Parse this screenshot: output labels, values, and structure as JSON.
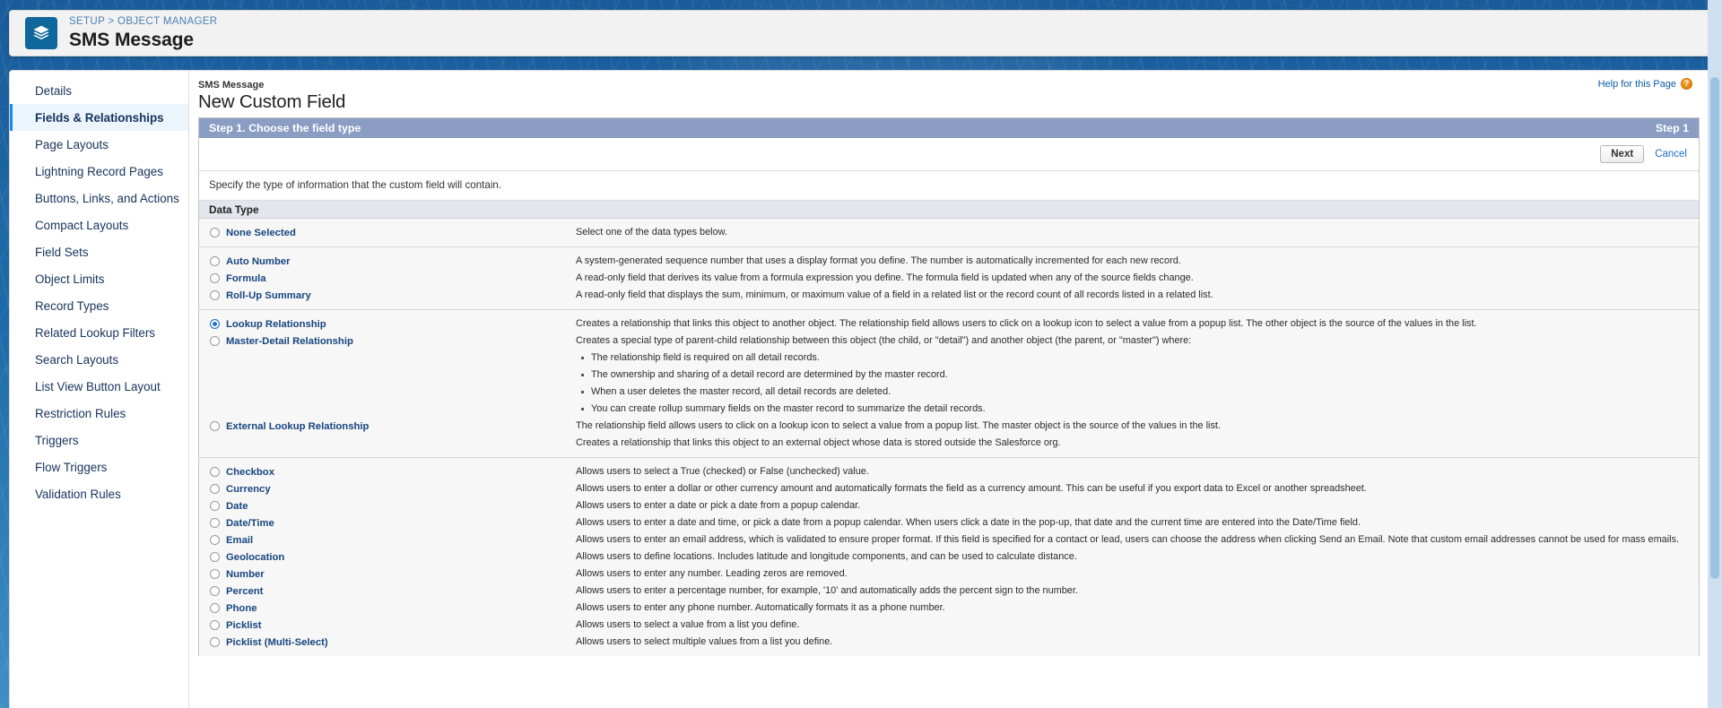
{
  "theme": {
    "brand_blue": "#1b5f9e",
    "icon_blue": "#10679b",
    "step_bar": "#8b9dc3",
    "link_blue": "#17457f",
    "active_nav": "#ecf4fc"
  },
  "global_header": {
    "breadcrumb": "SETUP > OBJECT MANAGER",
    "object_title": "SMS Message",
    "icon": "layers-icon"
  },
  "sidebar": {
    "items": [
      {
        "label": "Details",
        "active": false
      },
      {
        "label": "Fields & Relationships",
        "active": true
      },
      {
        "label": "Page Layouts",
        "active": false
      },
      {
        "label": "Lightning Record Pages",
        "active": false
      },
      {
        "label": "Buttons, Links, and Actions",
        "active": false
      },
      {
        "label": "Compact Layouts",
        "active": false
      },
      {
        "label": "Field Sets",
        "active": false
      },
      {
        "label": "Object Limits",
        "active": false
      },
      {
        "label": "Record Types",
        "active": false
      },
      {
        "label": "Related Lookup Filters",
        "active": false
      },
      {
        "label": "Search Layouts",
        "active": false
      },
      {
        "label": "List View Button Layout",
        "active": false
      },
      {
        "label": "Restriction Rules",
        "active": false
      },
      {
        "label": "Triggers",
        "active": false
      },
      {
        "label": "Flow Triggers",
        "active": false
      },
      {
        "label": "Validation Rules",
        "active": false
      }
    ]
  },
  "main": {
    "eyebrow": "SMS Message",
    "page_heading": "New Custom Field",
    "help_link": "Help for this Page",
    "help_icon_glyph": "?",
    "step_title": "Step 1. Choose the field type",
    "step_counter": "Step 1",
    "next_label": "Next",
    "cancel_label": "Cancel",
    "instruction": "Specify the type of information that the custom field will contain.",
    "datatype_header": "Data Type"
  },
  "data_types": {
    "group1": {
      "options": [
        {
          "label": "None Selected",
          "selected": false
        }
      ],
      "descriptions": [
        "Select one of the data types below."
      ]
    },
    "group2": {
      "options": [
        {
          "label": "Auto Number",
          "selected": false
        },
        {
          "label": "Formula",
          "selected": false
        },
        {
          "label": "Roll-Up Summary",
          "selected": false
        }
      ],
      "descriptions": [
        "A system-generated sequence number that uses a display format you define. The number is automatically incremented for each new record.",
        "A read-only field that derives its value from a formula expression you define. The formula field is updated when any of the source fields change.",
        "A read-only field that displays the sum, minimum, or maximum value of a field in a related list or the record count of all records listed in a related list."
      ]
    },
    "group3": {
      "options": [
        {
          "label": "Lookup Relationship",
          "selected": true
        },
        {
          "label": "Master-Detail Relationship",
          "selected": false
        },
        {
          "label": "External Lookup Relationship",
          "selected": false
        }
      ],
      "lookup_desc": "Creates a relationship that links this object to another object. The relationship field allows users to click on a lookup icon to select a value from a popup list. The other object is the source of the values in the list.",
      "masterdetail_intro": "Creates a special type of parent-child relationship between this object (the child, or \"detail\") and another object (the parent, or \"master\") where:",
      "masterdetail_bullets": [
        "The relationship field is required on all detail records.",
        "The ownership and sharing of a detail record are determined by the master record.",
        "When a user deletes the master record, all detail records are deleted.",
        "You can create rollup summary fields on the master record to summarize the detail records."
      ],
      "masterdetail_outro": "The relationship field allows users to click on a lookup icon to select a value from a popup list. The master object is the source of the values in the list.",
      "external_desc": "Creates a relationship that links this object to an external object whose data is stored outside the Salesforce org."
    },
    "group4": {
      "options": [
        {
          "label": "Checkbox",
          "selected": false
        },
        {
          "label": "Currency",
          "selected": false
        },
        {
          "label": "Date",
          "selected": false
        },
        {
          "label": "Date/Time",
          "selected": false
        },
        {
          "label": "Email",
          "selected": false
        },
        {
          "label": "Geolocation",
          "selected": false
        },
        {
          "label": "Number",
          "selected": false
        },
        {
          "label": "Percent",
          "selected": false
        },
        {
          "label": "Phone",
          "selected": false
        },
        {
          "label": "Picklist",
          "selected": false
        },
        {
          "label": "Picklist (Multi-Select)",
          "selected": false
        }
      ],
      "descriptions": [
        "Allows users to select a True (checked) or False (unchecked) value.",
        "Allows users to enter a dollar or other currency amount and automatically formats the field as a currency amount. This can be useful if you export data to Excel or another spreadsheet.",
        "Allows users to enter a date or pick a date from a popup calendar.",
        "Allows users to enter a date and time, or pick a date from a popup calendar. When users click a date in the pop-up, that date and the current time are entered into the Date/Time field.",
        "Allows users to enter an email address, which is validated to ensure proper format. If this field is specified for a contact or lead, users can choose the address when clicking Send an Email. Note that custom email addresses cannot be used for mass emails.",
        "Allows users to define locations. Includes latitude and longitude components, and can be used to calculate distance.",
        "Allows users to enter any number. Leading zeros are removed.",
        "Allows users to enter a percentage number, for example, '10' and automatically adds the percent sign to the number.",
        "Allows users to enter any phone number. Automatically formats it as a phone number.",
        "Allows users to select a value from a list you define.",
        "Allows users to select multiple values from a list you define."
      ]
    }
  }
}
